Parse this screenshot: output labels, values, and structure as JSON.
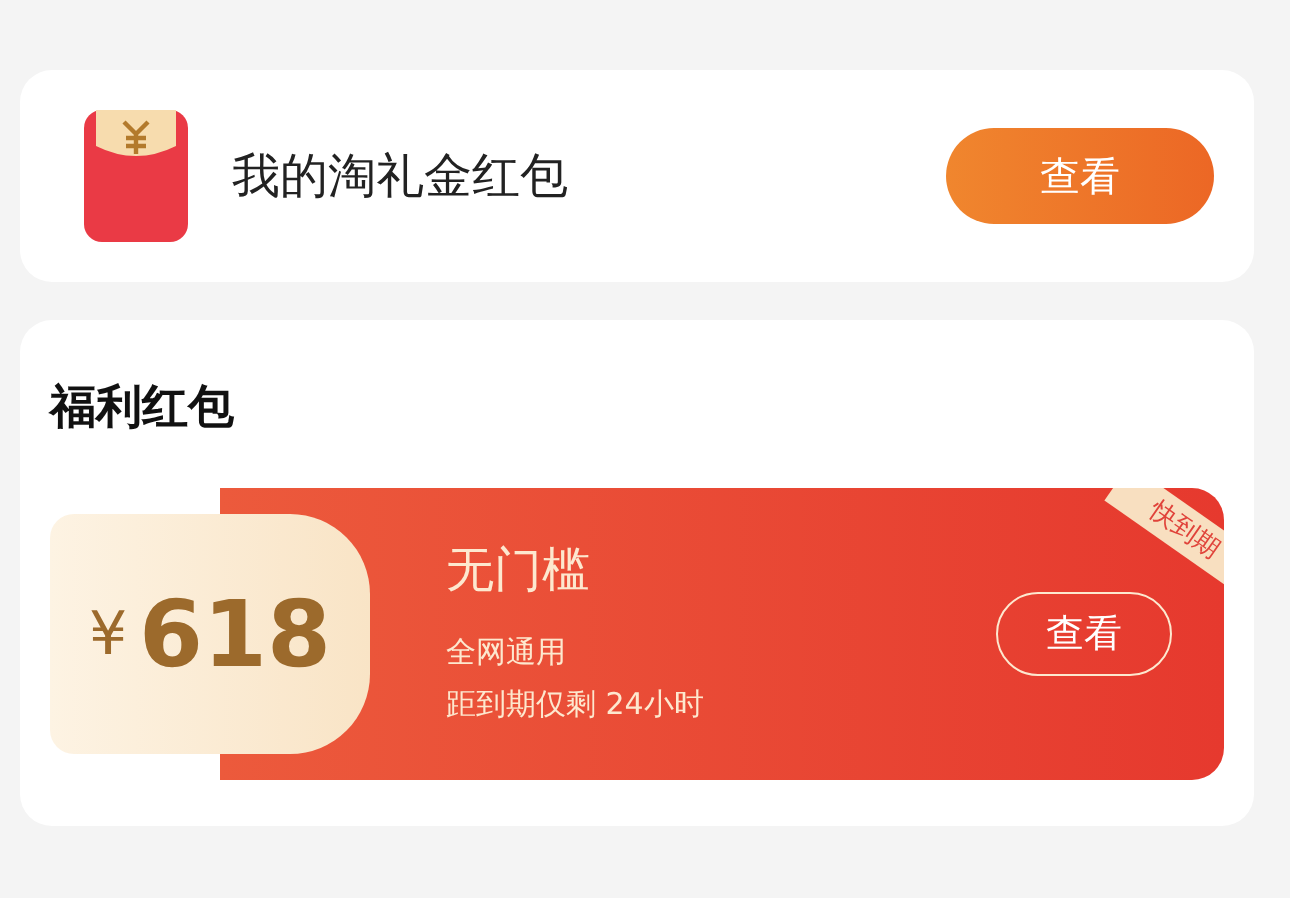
{
  "wallet": {
    "title": "我的淘礼金红包",
    "button": "查看"
  },
  "section": {
    "title": "福利红包",
    "coupons": [
      {
        "currency": "¥",
        "amount": "618",
        "name": "无门槛",
        "scope": "全网通用",
        "expiry": "距到期仅剩 24小时",
        "tag": "快到期",
        "button": "查看"
      }
    ]
  }
}
